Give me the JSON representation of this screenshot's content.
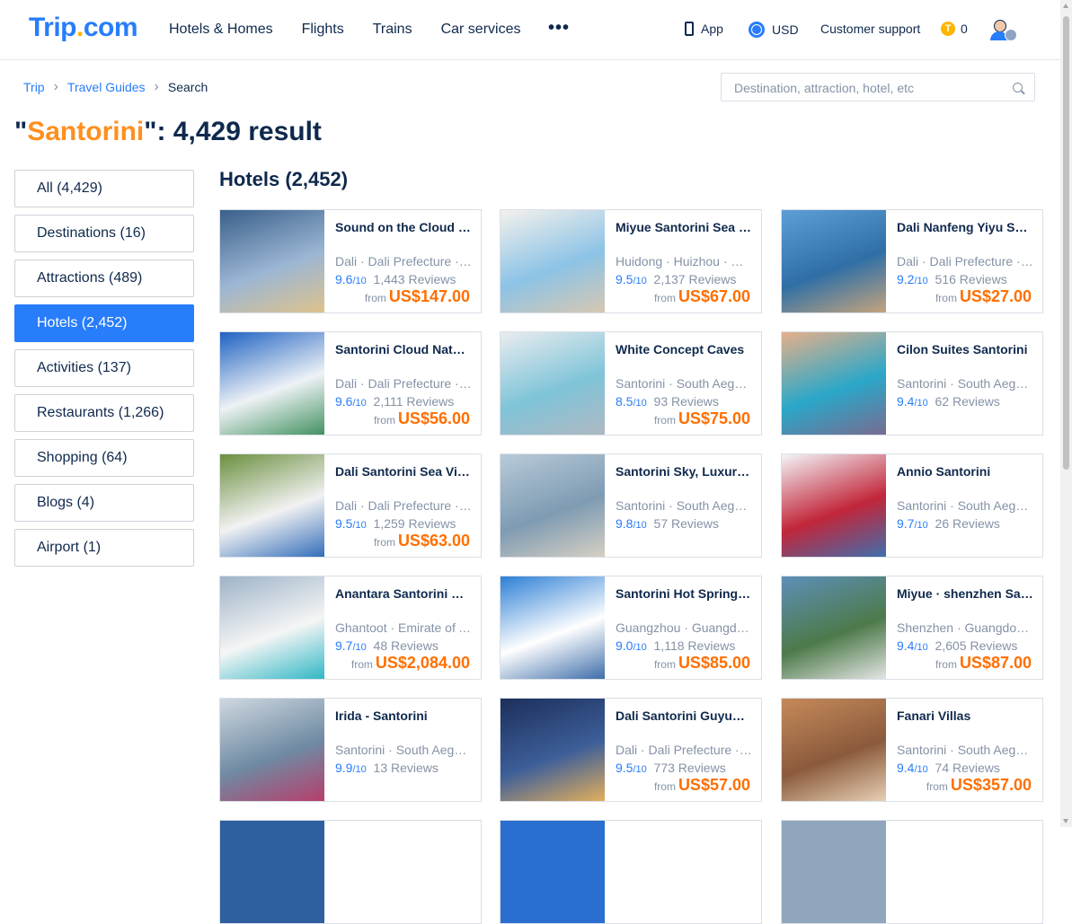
{
  "header": {
    "logo_main": "Trip",
    "logo_dot": ".",
    "logo_com": "com",
    "nav": [
      "Hotels & Homes",
      "Flights",
      "Trains",
      "Car services"
    ],
    "more": "•••",
    "app_label": "App",
    "currency": "USD",
    "support": "Customer support",
    "coin_symbol": "T",
    "coins": "0"
  },
  "breadcrumb": {
    "items": [
      "Trip",
      "Travel Guides"
    ],
    "separator": "›",
    "current": "Search"
  },
  "search": {
    "placeholder": "Destination, attraction, hotel, etc"
  },
  "title": {
    "open_quote": "\"",
    "query": "Santorini",
    "rest": "\": 4,429 result"
  },
  "sidebar": {
    "items": [
      "All (4,429)",
      "Destinations (16)",
      "Attractions (489)",
      "Hotels (2,452)",
      "Activities (137)",
      "Restaurants (1,266)",
      "Shopping (64)",
      "Blogs (4)",
      "Airport (1)"
    ],
    "active_index": 3
  },
  "section_title": "Hotels (2,452)",
  "rating_suffix": "/10",
  "from_label": "from",
  "hotels": [
    {
      "name": "Sound on the Cloud Sea View Hotel",
      "location": "Dali · Dali Prefecture · Yunnan",
      "score": "9.6",
      "reviews": "1,443 Reviews",
      "price": "US$147.00",
      "img": [
        "#3a5f8a",
        "#9bb6d4",
        "#e0c38a"
      ]
    },
    {
      "name": "Miyue Santorini Sea View Hotel",
      "location": "Huidong · Huizhou · Guangdong",
      "score": "9.5",
      "reviews": "2,137 Reviews",
      "price": "US$67.00",
      "img": [
        "#f4f1ec",
        "#8cc3e6",
        "#d9c8b0"
      ]
    },
    {
      "name": "Dali Nanfeng Yiyu Sea View Hotel",
      "location": "Dali · Dali Prefecture · Yunnan",
      "score": "9.2",
      "reviews": "516 Reviews",
      "price": "US$27.00",
      "img": [
        "#5d9fd6",
        "#2f6fa6",
        "#c9a57c"
      ]
    },
    {
      "name": "Santorini Cloud Nature Hotel",
      "location": "Dali · Dali Prefecture · Yunnan",
      "score": "9.6",
      "reviews": "2,111 Reviews",
      "price": "US$56.00",
      "img": [
        "#1f62c2",
        "#eef2f6",
        "#3e8f5c"
      ]
    },
    {
      "name": "White Concept Caves",
      "location": "Santorini · South Aegean · Greece",
      "score": "8.5",
      "reviews": "93 Reviews",
      "price": "US$75.00",
      "img": [
        "#e9ecef",
        "#7fc4d8",
        "#b0b8c2"
      ]
    },
    {
      "name": "Cilon Suites Santorini",
      "location": "Santorini · South Aegean · Greece",
      "score": "9.4",
      "reviews": "62 Reviews",
      "price": "",
      "img": [
        "#e6b08a",
        "#2aa7c9",
        "#7a6a8f"
      ]
    },
    {
      "name": "Dali Santorini Sea View Hotel",
      "location": "Dali · Dali Prefecture · Yunnan",
      "score": "9.5",
      "reviews": "1,259 Reviews",
      "price": "US$63.00",
      "img": [
        "#6b8f3f",
        "#f2f2f2",
        "#2f6ab8"
      ]
    },
    {
      "name": "Santorini Sky, Luxury Resort",
      "location": "Santorini · South Aegean · Greece",
      "score": "9.8",
      "reviews": "57 Reviews",
      "price": "",
      "img": [
        "#b8cad9",
        "#7e9bb2",
        "#d8d1c4"
      ]
    },
    {
      "name": "Annio Santorini",
      "location": "Santorini · South Aegean · Greece",
      "score": "9.7",
      "reviews": "26 Reviews",
      "price": "",
      "img": [
        "#f3f5f8",
        "#c2263a",
        "#3d6fb0"
      ]
    },
    {
      "name": "Anantara Santorini Resort",
      "location": "Ghantoot · Emirate of Abu Dhabi",
      "score": "9.7",
      "reviews": "48 Reviews",
      "price": "US$2,084.00",
      "img": [
        "#9db3c8",
        "#f5f5f5",
        "#2bb6c4"
      ]
    },
    {
      "name": "Santorini Hot Spring Resort",
      "location": "Guangzhou · Guangdong · China",
      "score": "9.0",
      "reviews": "1,118 Reviews",
      "price": "US$85.00",
      "img": [
        "#2d7fd6",
        "#ffffff",
        "#3a6aa8"
      ]
    },
    {
      "name": "Miyue · shenzhen Santorini",
      "location": "Shenzhen · Guangdong · China",
      "score": "9.4",
      "reviews": "2,605 Reviews",
      "price": "US$87.00",
      "img": [
        "#5d8fb8",
        "#4d7a4a",
        "#e8e8e8"
      ]
    },
    {
      "name": "Irida - Santorini",
      "location": "Santorini · South Aegean · Greece",
      "score": "9.9",
      "reviews": "13 Reviews",
      "price": "",
      "img": [
        "#cfd8e0",
        "#6f8aa3",
        "#b93c6a"
      ]
    },
    {
      "name": "Dali Santorini Guyun Hotel",
      "location": "Dali · Dali Prefecture · Yunnan",
      "score": "9.5",
      "reviews": "773 Reviews",
      "price": "US$57.00",
      "img": [
        "#1c2f5a",
        "#3d5e99",
        "#e7b15b"
      ]
    },
    {
      "name": "Fanari Villas",
      "location": "Santorini · South Aegean · Greece",
      "score": "9.4",
      "reviews": "74 Reviews",
      "price": "US$357.00",
      "img": [
        "#c58a5a",
        "#8b5a3c",
        "#e9d3b8"
      ]
    }
  ],
  "partial_row_colors": [
    "#2e5f9e",
    "#2a6fd0",
    "#8fa6bd"
  ]
}
